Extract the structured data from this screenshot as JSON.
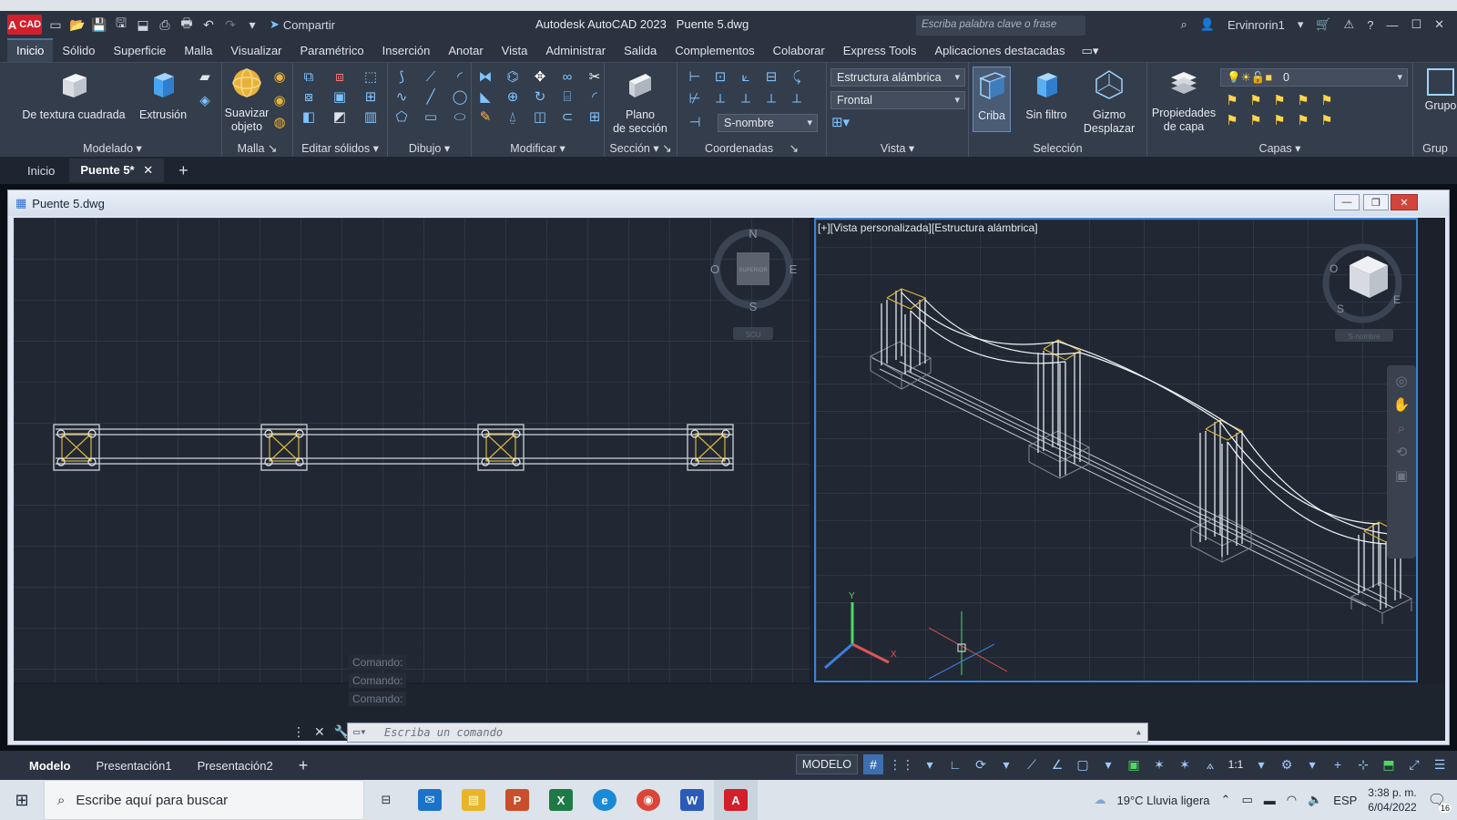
{
  "app": {
    "logo_text": "CAD",
    "share_label": "Compartir",
    "title": "Autodesk AutoCAD 2023",
    "file_name": "Puente 5.dwg",
    "search_placeholder": "Escriba palabra clave o frase",
    "user_name": "Ervinrorin1"
  },
  "ribbon_tabs": [
    "Inicio",
    "Sólido",
    "Superficie",
    "Malla",
    "Visualizar",
    "Paramétrico",
    "Inserción",
    "Anotar",
    "Vista",
    "Administrar",
    "Salida",
    "Complementos",
    "Colaborar",
    "Express Tools",
    "Aplicaciones destacadas"
  ],
  "ribbon": {
    "panels": {
      "modelado": "Modelado",
      "malla": "Malla",
      "editar_solidos": "Editar sólidos",
      "dibujo": "Dibujo",
      "modificar": "Modificar",
      "seccion": "Sección",
      "coordenadas": "Coordenadas",
      "vista": "Vista",
      "seleccion": "Selección",
      "capas": "Capas",
      "grupos": "Grup"
    },
    "buttons": {
      "textura_cuadrada": "De textura cuadrada",
      "extrusion": "Extrusión",
      "suavizar_1": "Suavizar",
      "suavizar_2": "objeto",
      "plano_1": "Plano",
      "plano_2": "de sección",
      "criba": "Criba",
      "sin_filtro": "Sin filtro",
      "gizmo_1": "Gizmo",
      "gizmo_2": "Desplazar",
      "prop_capa_1": "Propiedades",
      "prop_capa_2": "de capa",
      "grupo": "Grupo"
    },
    "dropdowns": {
      "visual_style": "Estructura alámbrica",
      "view": "Frontal",
      "ucs": "S-nombre",
      "layer": "0"
    }
  },
  "doc_tabs": [
    "Inicio",
    "Puente 5*"
  ],
  "drawing_window": {
    "title": "Puente 5.dwg",
    "right_viewport_label": "[+][Vista personalizada][Estructura alámbrica]",
    "compass": {
      "n": "N",
      "s": "S",
      "e": "E",
      "w": "O",
      "cube_face": "SUPERIOR",
      "wcs": "SCU",
      "ucs_menu": "S-nombre"
    }
  },
  "command": {
    "history": [
      "Comando:",
      "Comando:",
      "Comando:"
    ],
    "placeholder": "Escriba un comando"
  },
  "layout_tabs": [
    "Modelo",
    "Presentación1",
    "Presentación2"
  ],
  "status": {
    "model": "MODELO",
    "scale": "1:1"
  },
  "taskbar": {
    "search_placeholder": "Escribe aquí para buscar",
    "weather": "19°C Lluvia ligera",
    "lang": "ESP",
    "time": "3:38 p. m.",
    "date": "6/04/2022",
    "notif_count": "16"
  }
}
